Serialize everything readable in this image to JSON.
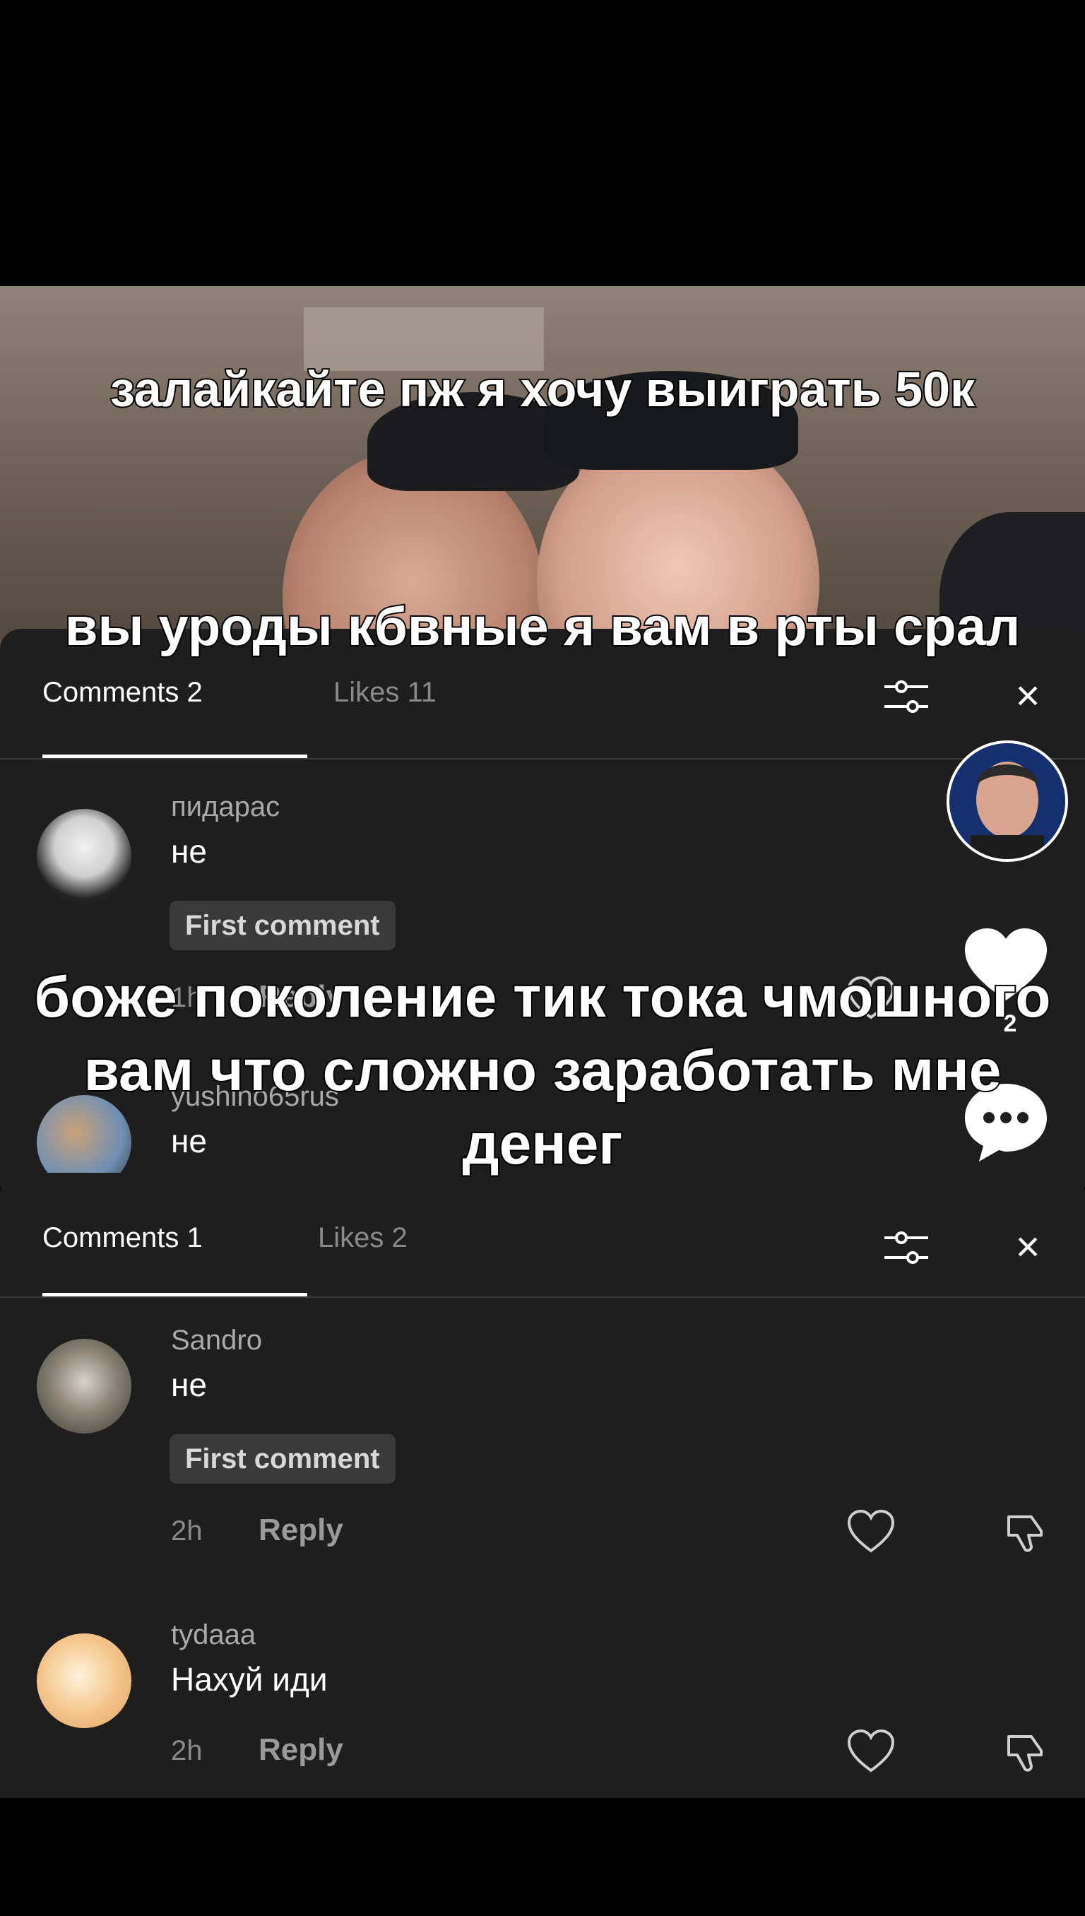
{
  "video": {
    "caption_top": "залайкайте пж я хочу выиграть 50к"
  },
  "overlay": {
    "line1": "вы уроды кбвные я вам в рты срал",
    "line2": "боже поколение тик тока чмошного вам что сложно заработать мне денег"
  },
  "sheet1": {
    "tab_comments": "Comments 2",
    "tab_likes": "Likes 11",
    "comments": [
      {
        "user": "пидарас",
        "text": "не",
        "badge": "First comment",
        "time": "1h",
        "reply": "Reply"
      },
      {
        "user": "yushino65rus",
        "text": "не"
      }
    ]
  },
  "sheet2": {
    "tab_comments": "Comments 1",
    "tab_likes": "Likes 2",
    "comments": [
      {
        "user": "Sandro",
        "text": "не",
        "badge": "First comment",
        "time": "2h",
        "reply": "Reply"
      },
      {
        "user": "tydaaa",
        "text": "Нахуй иди",
        "time": "2h",
        "reply": "Reply"
      }
    ]
  },
  "side": {
    "like_count": "2"
  },
  "colors": {
    "sheet_bg": "#1e1e1e",
    "accent": "#ffffff"
  },
  "icons": [
    "filter-icon",
    "close-icon",
    "heart-icon",
    "dislike-icon",
    "comment-icon"
  ]
}
